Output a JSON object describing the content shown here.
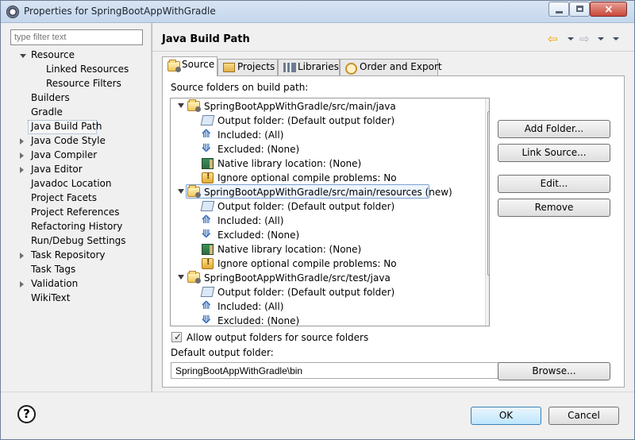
{
  "window": {
    "title": "Properties for SpringBootAppWithGradle",
    "controls": [
      "minimize",
      "maximize",
      "close"
    ],
    "close_symbol": "×",
    "icon": "gear-app-icon"
  },
  "left": {
    "filter_placeholder": "type filter text",
    "items": [
      {
        "label": "Resource",
        "expanded": true,
        "indent": 0
      },
      {
        "label": "Linked Resources",
        "expanded": null,
        "indent": 1
      },
      {
        "label": "Resource Filters",
        "expanded": null,
        "indent": 1
      },
      {
        "label": "Builders",
        "expanded": null,
        "indent": 0
      },
      {
        "label": "Gradle",
        "expanded": null,
        "indent": 0
      },
      {
        "label": "Java Build Path",
        "expanded": null,
        "indent": 0,
        "selected": true
      },
      {
        "label": "Java Code Style",
        "expanded": false,
        "indent": 0
      },
      {
        "label": "Java Compiler",
        "expanded": false,
        "indent": 0
      },
      {
        "label": "Java Editor",
        "expanded": false,
        "indent": 0
      },
      {
        "label": "Javadoc Location",
        "expanded": null,
        "indent": 0
      },
      {
        "label": "Project Facets",
        "expanded": null,
        "indent": 0
      },
      {
        "label": "Project References",
        "expanded": null,
        "indent": 0
      },
      {
        "label": "Refactoring History",
        "expanded": null,
        "indent": 0
      },
      {
        "label": "Run/Debug Settings",
        "expanded": null,
        "indent": 0
      },
      {
        "label": "Task Repository",
        "expanded": false,
        "indent": 0
      },
      {
        "label": "Task Tags",
        "expanded": null,
        "indent": 0
      },
      {
        "label": "Validation",
        "expanded": false,
        "indent": 0
      },
      {
        "label": "WikiText",
        "expanded": null,
        "indent": 0
      }
    ]
  },
  "page": {
    "title": "Java Build Path",
    "nav_back": "⇦",
    "nav_forward": "⇨",
    "tabs": [
      {
        "label": "Source",
        "icon": "folder-source-icon",
        "active": true
      },
      {
        "label": "Projects",
        "icon": "project-icon",
        "active": false
      },
      {
        "label": "Libraries",
        "icon": "library-icon",
        "active": false
      },
      {
        "label": "Order and Export",
        "icon": "order-icon",
        "active": false
      }
    ],
    "section_label": "Source folders on build path:",
    "tree": [
      {
        "text": "SpringBootAppWithGradle/src/main/java",
        "kind": "folder",
        "expanded": true
      },
      {
        "text": "Output folder: (Default output folder)",
        "kind": "output"
      },
      {
        "text": "Included: (All)",
        "kind": "include"
      },
      {
        "text": "Excluded: (None)",
        "kind": "exclude"
      },
      {
        "text": "Native library location: (None)",
        "kind": "native"
      },
      {
        "text": "Ignore optional compile problems: No",
        "kind": "ignore"
      },
      {
        "text": "SpringBootAppWithGradle/src/main/resources (new)",
        "kind": "folder",
        "expanded": true,
        "selected": true
      },
      {
        "text": "Output folder: (Default output folder)",
        "kind": "output"
      },
      {
        "text": "Included: (All)",
        "kind": "include"
      },
      {
        "text": "Excluded: (None)",
        "kind": "exclude"
      },
      {
        "text": "Native library location: (None)",
        "kind": "native"
      },
      {
        "text": "Ignore optional compile problems: No",
        "kind": "ignore"
      },
      {
        "text": "SpringBootAppWithGradle/src/test/java",
        "kind": "folder",
        "expanded": true
      },
      {
        "text": "Output folder: (Default output folder)",
        "kind": "output"
      },
      {
        "text": "Included: (All)",
        "kind": "include"
      },
      {
        "text": "Excluded: (None)",
        "kind": "exclude"
      }
    ],
    "buttons": [
      "Add Folder...",
      "Link Source...",
      "Edit...",
      "Remove"
    ],
    "allow_output_label": "Allow output folders for source folders",
    "allow_output_checked": true,
    "default_output_label": "Default output folder:",
    "default_output_value": "SpringBootAppWithGradle\\bin",
    "browse": "Browse..."
  },
  "bottom": {
    "help": "?",
    "ok": "OK",
    "cancel": "Cancel"
  }
}
